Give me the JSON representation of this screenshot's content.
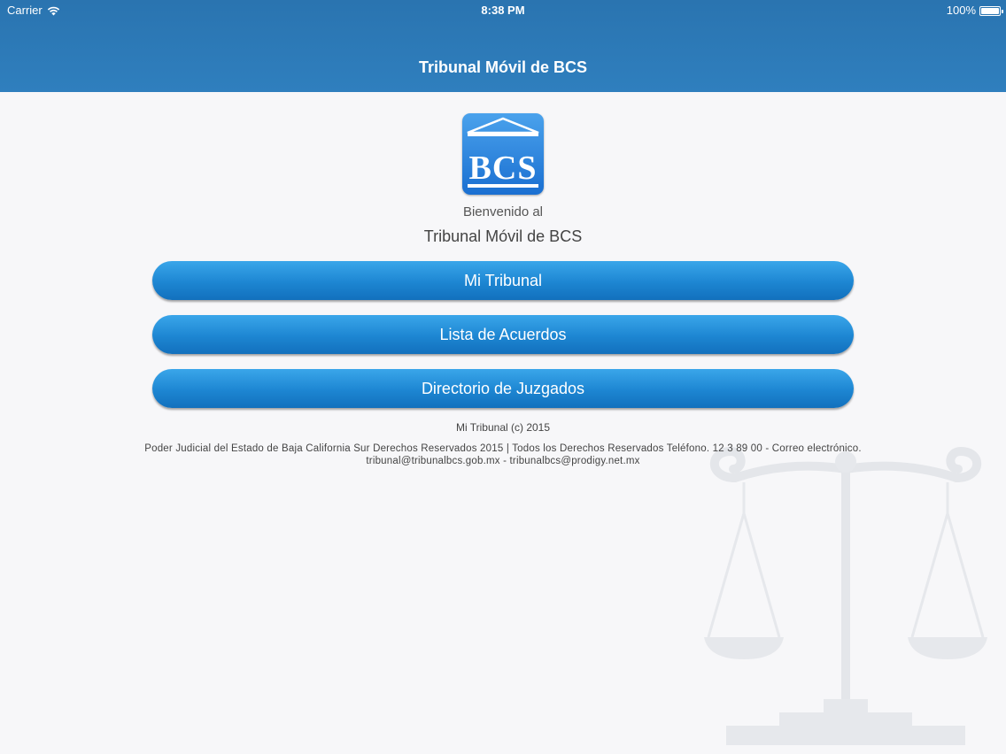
{
  "status_bar": {
    "carrier": "Carrier",
    "time": "8:38 PM",
    "battery": "100%"
  },
  "nav": {
    "title": "Tribunal Móvil de BCS"
  },
  "logo": {
    "text": "BCS"
  },
  "welcome": {
    "line1": "Bienvenido al",
    "line2": "Tribunal Móvil de BCS"
  },
  "menu": {
    "items": [
      {
        "label": "Mi Tribunal"
      },
      {
        "label": "Lista de Acuerdos"
      },
      {
        "label": "Directorio de Juzgados"
      }
    ]
  },
  "footer": {
    "copyright": "Mi Tribunal (c) 2015",
    "line1": "Poder Judicial del Estado de Baja California Sur  Derechos Reservados 2015 | Todos los Derechos Reservados  Teléfono. 12 3 89 00 - Correo electrónico.",
    "line2": "tribunal@tribunalbcs.gob.mx - tribunalbcs@prodigy.net.mx"
  },
  "colors": {
    "nav_bar": "#2f7fbe",
    "button": "#1d86d2",
    "background": "#f7f7f9"
  }
}
